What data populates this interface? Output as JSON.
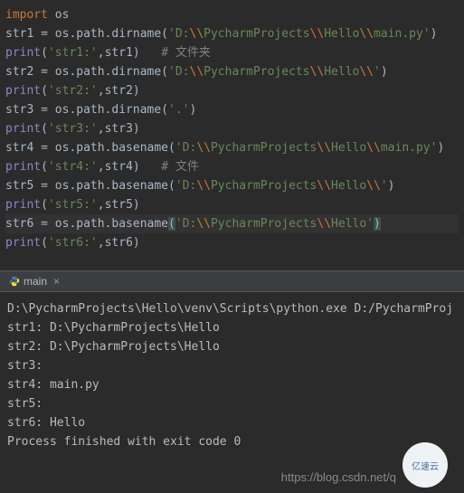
{
  "editor": {
    "line1": {
      "kw": "import ",
      "mod": "os"
    },
    "line2": {
      "pre": "str1 = os.path.dirname(",
      "str_open": "'D:",
      "esc1": "\\\\",
      "s1": "PycharmProjects",
      "esc2": "\\\\",
      "s2": "Hello",
      "esc3": "\\\\",
      "s3": "main.py'",
      "close": ")"
    },
    "line3": {
      "fn": "print",
      "open": "(",
      "str": "'str1:'",
      "comma": ",",
      "arg": "str1",
      "close": ")   ",
      "comment": "# 文件夹"
    },
    "line4": {
      "pre": "str2 = os.path.dirname(",
      "str_open": "'D:",
      "esc1": "\\\\",
      "s1": "PycharmProjects",
      "esc2": "\\\\",
      "s2": "Hello",
      "esc3": "\\\\",
      "s3": "'",
      "close": ")"
    },
    "line5": {
      "fn": "print",
      "open": "(",
      "str": "'str2:'",
      "comma": ",",
      "arg": "str2",
      "close": ")"
    },
    "line6": {
      "pre": "str3 = os.path.dirname(",
      "str": "'.'",
      "close": ")"
    },
    "line7": {
      "fn": "print",
      "open": "(",
      "str": "'str3:'",
      "comma": ",",
      "arg": "str3",
      "close": ")"
    },
    "line8": "",
    "line9": {
      "pre": "str4 = os.path.basename(",
      "str_open": "'D:",
      "esc1": "\\\\",
      "s1": "PycharmProjects",
      "esc2": "\\\\",
      "s2": "Hello",
      "esc3": "\\\\",
      "s3": "main.py'",
      "close": ")"
    },
    "line10": {
      "fn": "print",
      "open": "(",
      "str": "'str4:'",
      "comma": ",",
      "arg": "str4",
      "close": ")   ",
      "comment": "# 文件"
    },
    "line11": {
      "pre": "str5 = os.path.basename(",
      "str_open": "'D:",
      "esc1": "\\\\",
      "s1": "PycharmProjects",
      "esc2": "\\\\",
      "s2": "Hello",
      "esc3": "\\\\",
      "s3": "'",
      "close": ")"
    },
    "line12": {
      "fn": "print",
      "open": "(",
      "str": "'str5:'",
      "comma": ",",
      "arg": "str5",
      "close": ")"
    },
    "line13": {
      "pre": "str6 = os.path.basename",
      "open": "(",
      "str_open": "'D:",
      "esc1": "\\\\",
      "s1": "PycharmProjects",
      "esc2": "\\\\",
      "s2": "Hello'",
      "close": ")"
    },
    "line14": {
      "fn": "print",
      "open": "(",
      "str": "'str6:'",
      "comma": ",",
      "arg": "str6",
      "close": ")"
    }
  },
  "tab": {
    "label": "main"
  },
  "console": {
    "l1": "D:\\PycharmProjects\\Hello\\venv\\Scripts\\python.exe D:/PycharmProj",
    "l2": "str1: D:\\PycharmProjects\\Hello",
    "l3": "str2: D:\\PycharmProjects\\Hello",
    "l4": "str3:",
    "l5": "str4: main.py",
    "l6": "str5:",
    "l7": "str6: Hello",
    "l8": "",
    "l9": "Process finished with exit code 0"
  },
  "watermark": "https://blog.csdn.net/q",
  "logo": "亿速云"
}
